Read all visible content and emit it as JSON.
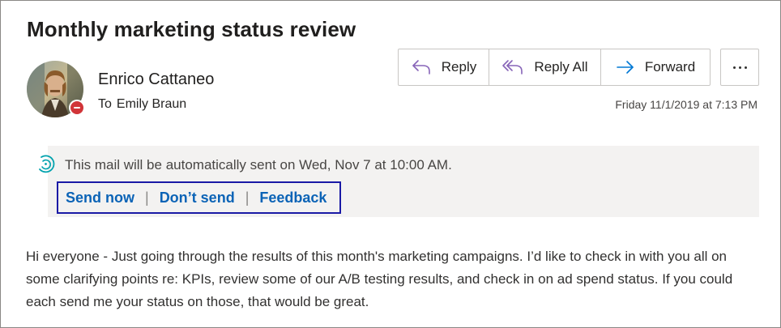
{
  "message": {
    "subject": "Monthly marketing status review",
    "sender_name": "Enrico Cattaneo",
    "to_label": "To",
    "recipient": "Emily Braun",
    "timestamp": "Friday 11/1/2019 at 7:13 PM",
    "presence_status": "busy",
    "body": "Hi everyone - Just going through the results of this month's marketing campaigns. I’d like to check in with you all on some clarifying points re: KPIs, review some of our A/B testing results, and check in on ad spend status. If you could each send me your status on those, that would be great."
  },
  "actions": {
    "reply_label": "Reply",
    "reply_all_label": "Reply All",
    "forward_label": "Forward",
    "more_icon": "more-horizontal-icon"
  },
  "scheduled_send": {
    "message": "This mail will be automatically sent on Wed, Nov 7 at 10:00 AM.",
    "links": [
      "Send now",
      "Don’t send",
      "Feedback"
    ],
    "separator": "|"
  },
  "colors": {
    "link": "#0b63b6",
    "reply_icon": "#8764b8",
    "forward_icon": "#0078d4",
    "schedule_icon": "#00a2ad",
    "presence_busy": "#d13438",
    "highlight_border": "#1a1aa6",
    "infobar_bg": "#f3f2f1"
  }
}
